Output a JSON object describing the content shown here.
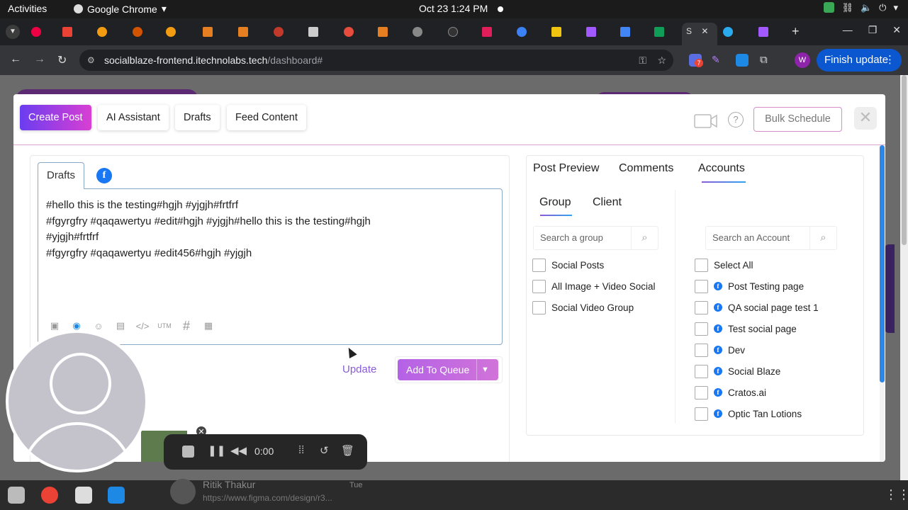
{
  "system_bar": {
    "activities": "Activities",
    "app_menu": "Google Chrome",
    "clock": "Oct 23  1:24 PM"
  },
  "browser": {
    "active_tab_label": "S",
    "url_host": "socialblaze-frontend.itechnolabs.tech",
    "url_path": "/dashboard#",
    "profile_initial": "W",
    "finish_update": "Finish update",
    "extension_badge": "7"
  },
  "modal": {
    "tabs": [
      "Create Post",
      "AI Assistant",
      "Drafts",
      "Feed Content"
    ],
    "bulk_schedule": "Bulk Schedule",
    "help": "?",
    "close": "✕"
  },
  "editor": {
    "drafts_tab": "Drafts",
    "fb_glyph": "f",
    "lines": [
      "#hello this is the testing#hgjh #yjgjh#frtfrf",
      "#fgyrgfry #qaqawertyu #edit#hgjh #yjgjh#hello this is the testing#hgjh",
      "#yjgjh#frtfrf",
      "#fgyrgfry #qaqawertyu #edit456#hgjh #yjgjh"
    ],
    "toolbar_utm": "UTM",
    "update": "Update",
    "add_to_queue": "Add To Queue"
  },
  "right_panel": {
    "tabs": [
      "Post Preview",
      "Comments",
      "Accounts"
    ],
    "active_tab": "Accounts",
    "subtabs": [
      "Group",
      "Client"
    ],
    "active_subtab": "Group",
    "search_group_placeholder": "Search a group",
    "search_account_placeholder": "Search an Account",
    "groups": [
      "Social Posts",
      "All Image + Video Social",
      "Social Video Group"
    ],
    "select_all": "Select All",
    "accounts": [
      "Post Testing page",
      "QA social page test 1",
      "Test social page",
      "Dev",
      "Social Blaze",
      "Cratos.ai",
      "Optic Tan Lotions"
    ]
  },
  "recorder": {
    "time": "0:00"
  },
  "background_chat": {
    "name": "Ritik Thakur",
    "link": "https://www.figma.com/design/r3...",
    "day": "Tue"
  },
  "colors": {
    "accent_gradient_start": "#6a3df0",
    "accent_gradient_end": "#d93fd3",
    "queue_button": "#c06ae0",
    "facebook_blue": "#1877f2",
    "chrome_update_blue": "#0b57d0"
  }
}
